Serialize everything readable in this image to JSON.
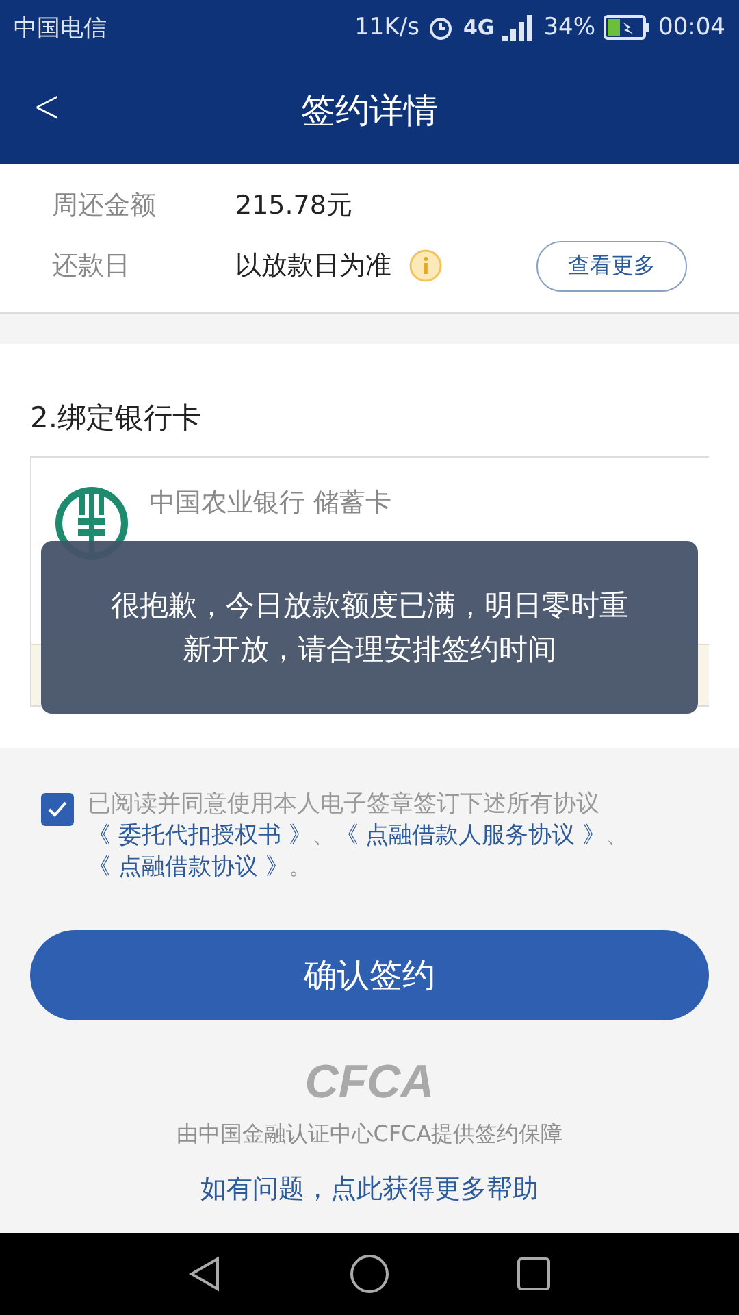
{
  "status_bar": {
    "carrier": "中国电信",
    "speed": "11K/s",
    "network": "4G",
    "battery": "34%",
    "time": "00:04"
  },
  "header": {
    "back": "<",
    "title": "签约详情"
  },
  "summary": {
    "rows": [
      {
        "label": "周还金额",
        "value": "215.78元",
        "info": false
      },
      {
        "label": "还款日",
        "value": "以放款日为准",
        "info": true
      }
    ],
    "more_button": "查看更多"
  },
  "bank_section": {
    "title": "2.绑定银行卡",
    "card": {
      "bank": "中国农业银行 储蓄卡"
    }
  },
  "toast": "很抱歉，今日放款额度已满，明日零时重新开放，请合理安排签约时间",
  "agreement": {
    "checked": true,
    "segments": [
      {
        "kind": "text",
        "text": "已阅读并同意使用本人电子签章签订下述所有协议"
      },
      {
        "kind": "link",
        "text": "《 委托代扣授权书 》"
      },
      {
        "kind": "text",
        "text": "、"
      },
      {
        "kind": "link",
        "text": "《 点融借款人服务协议 》"
      },
      {
        "kind": "text",
        "text": "、"
      },
      {
        "kind": "link",
        "text": "《 点融借款协议 》"
      },
      {
        "kind": "text",
        "text": "。"
      }
    ]
  },
  "confirm_button": "确认签约",
  "footer": {
    "logo": "CFCA",
    "note": "由中国金融认证中心CFCA提供签约保障",
    "help_link": "如有问题，点此获得更多帮助"
  }
}
